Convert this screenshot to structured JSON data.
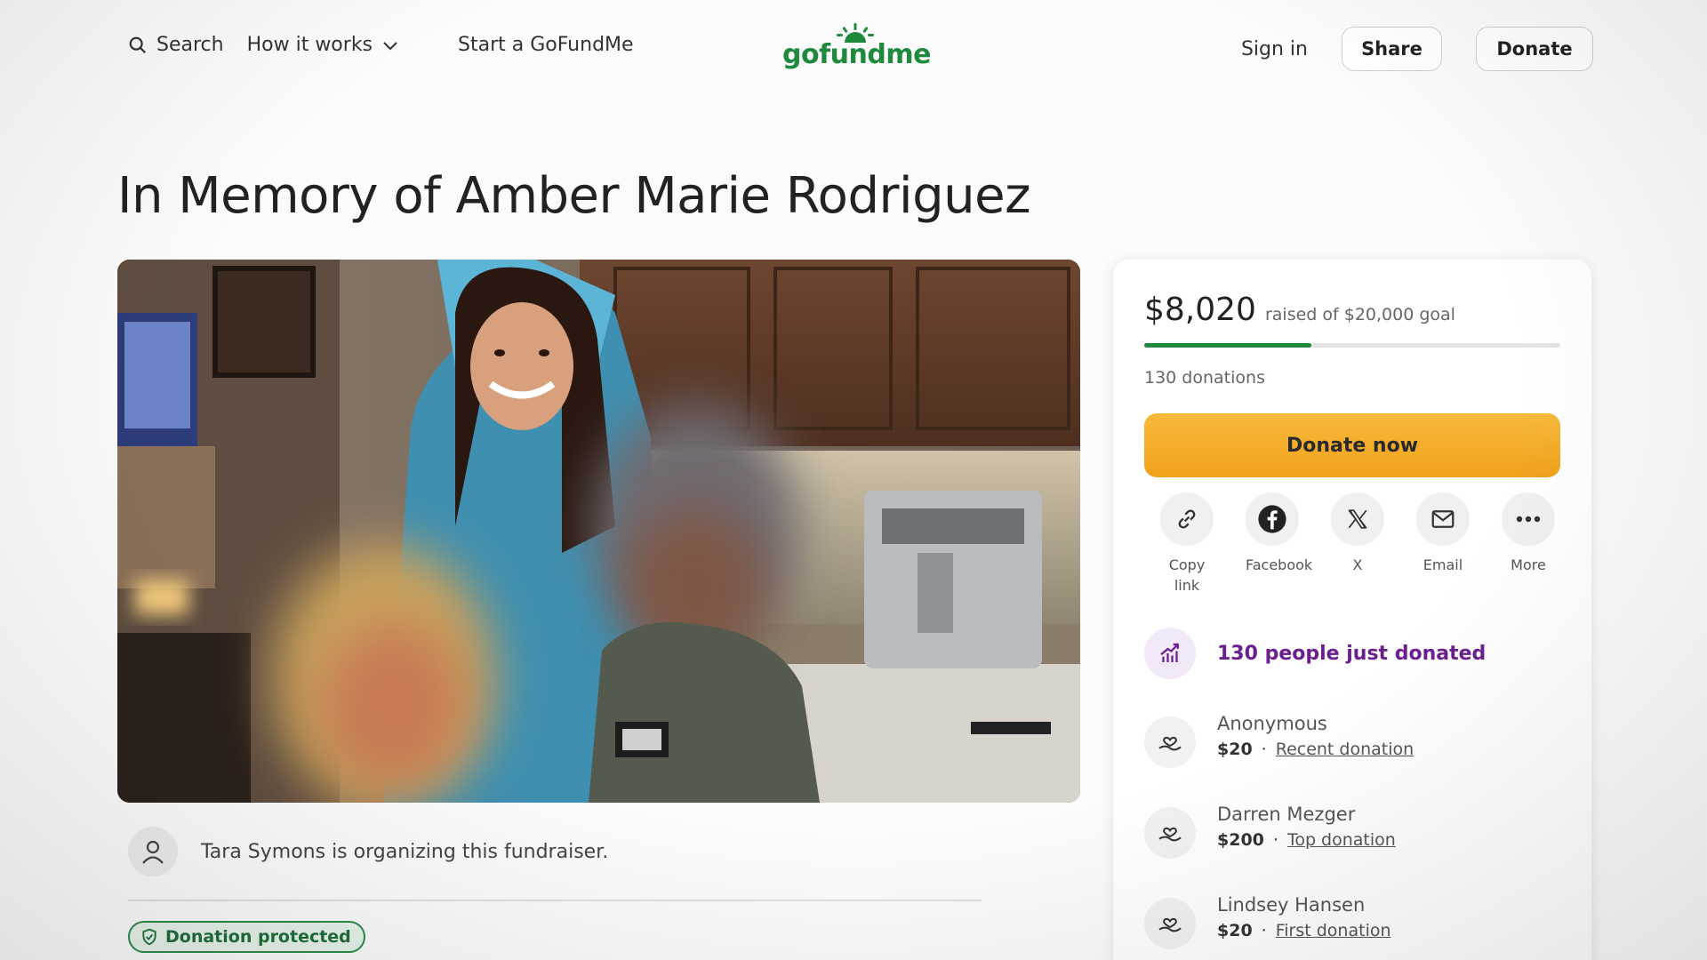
{
  "header": {
    "search_label": "Search",
    "how_it_works_label": "How it works",
    "start_label": "Start a GoFundMe",
    "logo_text": "gofundme",
    "signin_label": "Sign in",
    "share_label": "Share",
    "donate_label": "Donate"
  },
  "page": {
    "title": "In Memory of Amber Marie Rodriguez"
  },
  "organizer": {
    "text": "Tara Symons is organizing this fundraiser."
  },
  "badge": {
    "label": "Donation protected"
  },
  "sidebar": {
    "raised": "$8,020",
    "goal_text": "raised of $20,000 goal",
    "progress_fraction": 0.401,
    "donations_count": "130 donations",
    "donate_now_label": "Donate now",
    "share_options": [
      {
        "label": "Copy link",
        "icon": "link-icon"
      },
      {
        "label": "Facebook",
        "icon": "facebook-icon"
      },
      {
        "label": "X",
        "icon": "x-icon"
      },
      {
        "label": "Email",
        "icon": "email-icon"
      },
      {
        "label": "More",
        "icon": "more-icon"
      }
    ],
    "just_donated": "130 people just donated",
    "donors": [
      {
        "name": "Anonymous",
        "amount": "$20",
        "sep": "·",
        "type": "Recent donation"
      },
      {
        "name": "Darren Mezger",
        "amount": "$200",
        "sep": "·",
        "type": "Top donation"
      },
      {
        "name": "Lindsey Hansen",
        "amount": "$20",
        "sep": "·",
        "type": "First donation"
      }
    ]
  },
  "colors": {
    "brand_green": "#1f8a3e",
    "donate_orange": "#f5ad2c",
    "purple": "#6b1f8e"
  }
}
